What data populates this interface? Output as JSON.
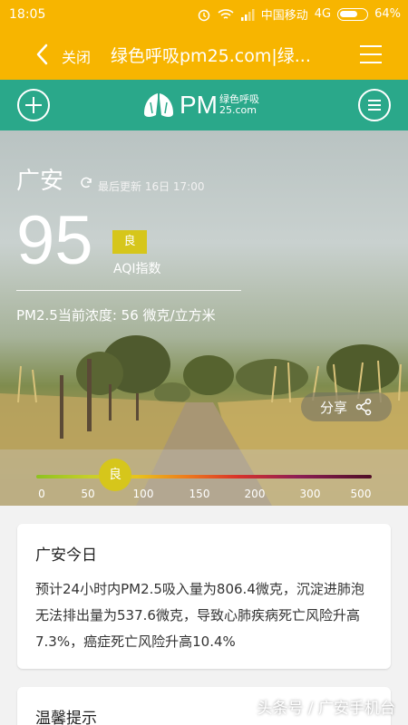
{
  "status_bar": {
    "time": "18:05",
    "carrier": "中国移动",
    "network": "4G",
    "battery": "64%",
    "battery_level_percent": 64
  },
  "title_bar": {
    "close_label": "关闭",
    "title": "绿色呼吸pm25.com|绿..."
  },
  "app_header": {
    "logo_pm": "PM",
    "logo_cn": "绿色呼吸",
    "logo_domain": "25.com"
  },
  "hero": {
    "city": "广安",
    "updated": "最后更新 16日 17:00",
    "aqi": "95",
    "level": "良",
    "aqi_label": "AQI指数",
    "pm25_text": "PM2.5当前浓度: 56 微克/立方米",
    "share_label": "分享"
  },
  "scale": {
    "marker_label": "良",
    "marker_value": 95,
    "ticks": [
      "0",
      "50",
      "100",
      "150",
      "200",
      "300",
      "500"
    ]
  },
  "today_card": {
    "title": "广安今日",
    "text": "预计24小时内PM2.5吸入量为806.4微克，沉淀进肺泡无法排出量为537.6微克，导致心肺疾病死亡风险升高7.3%，癌症死亡风险升高10.4%"
  },
  "tips_card": {
    "title": "温馨提示"
  },
  "watermark": "头条号 / 广安手机台",
  "colors": {
    "title_bar": "#f7b500",
    "app_header": "#2aa88a",
    "level_good": "#d6c61b"
  }
}
